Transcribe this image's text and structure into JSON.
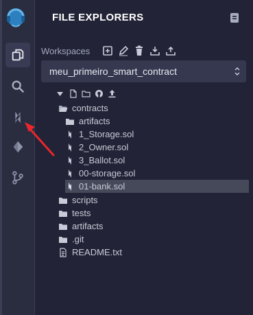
{
  "panel": {
    "title": "FILE EXPLORERS"
  },
  "workspace": {
    "label": "Workspaces",
    "selected": "meu_primeiro_smart_contract"
  },
  "sidebar_icons": [
    "remix-logo",
    "file-explorer-icon",
    "search-icon",
    "solidity-compiler-icon",
    "deploy-run-icon",
    "git-icon"
  ],
  "tree": [
    {
      "name": "contracts",
      "type": "folder-open"
    },
    {
      "name": "artifacts",
      "type": "folder"
    },
    {
      "name": "1_Storage.sol",
      "type": "sol"
    },
    {
      "name": "2_Owner.sol",
      "type": "sol"
    },
    {
      "name": "3_Ballot.sol",
      "type": "sol"
    },
    {
      "name": "00-storage.sol",
      "type": "sol"
    },
    {
      "name": "01-bank.sol",
      "type": "sol",
      "selected": true
    },
    {
      "name": "scripts",
      "type": "folder"
    },
    {
      "name": "tests",
      "type": "folder"
    },
    {
      "name": "artifacts",
      "type": "folder"
    },
    {
      "name": ".git",
      "type": "folder"
    },
    {
      "name": "README.txt",
      "type": "file"
    }
  ],
  "colors": {
    "background": "#222336",
    "rail": "#2a2c3f",
    "accent": "#1e90c9",
    "selected_row": "#454959",
    "annotation_arrow": "#e8272d"
  }
}
